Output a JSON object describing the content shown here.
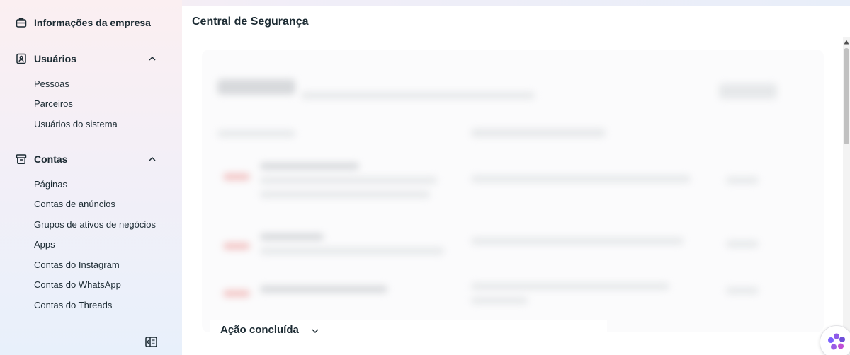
{
  "sidebar": {
    "company_info": {
      "label": "Informações da empresa",
      "icon": "briefcase-icon"
    },
    "users": {
      "label": "Usuários",
      "icon": "user-badge-icon",
      "items": [
        "Pessoas",
        "Parceiros",
        "Usuários do sistema"
      ]
    },
    "accounts": {
      "label": "Contas",
      "icon": "archive-box-icon",
      "items": [
        "Páginas",
        "Contas de anúncios",
        "Grupos de ativos de negócios",
        "Apps",
        "Contas do Instagram",
        "Contas do WhatsApp",
        "Contas do Threads"
      ]
    },
    "collapse_icon": "sidebar-collapse-icon"
  },
  "main": {
    "title": "Central de Segurança",
    "completed_section": {
      "label": "Ação concluída",
      "icon": "chevron-down-icon"
    }
  },
  "colors": {
    "accent": "#6f4fd9",
    "text": "#1c2b33",
    "sidebar_bg_top": "#fbeff1",
    "sidebar_bg_bottom": "#e8f0fb"
  }
}
